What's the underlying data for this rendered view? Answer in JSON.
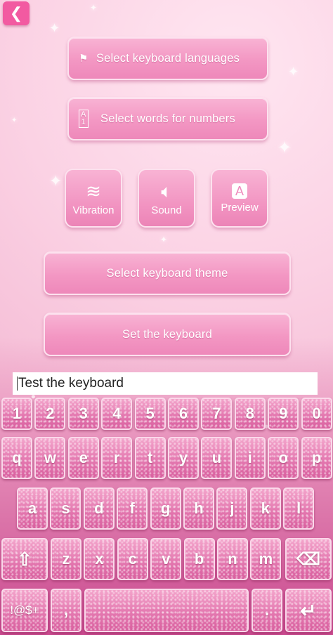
{
  "menu": {
    "languages_label": "Select keyboard languages",
    "numbers_label": "Select words for numbers",
    "vibration_label": "Vibration",
    "sound_label": "Sound",
    "preview_label": "Preview",
    "theme_label": "Select keyboard theme",
    "set_label": "Set the keyboard"
  },
  "icons": {
    "back": "chevron-left-icon",
    "languages": "flag-icon",
    "numbers": "a1-icon",
    "vibration": "vibration-icon",
    "sound": "speaker-icon",
    "preview": "preview-a-icon"
  },
  "test_field": {
    "value": "Test the keyboard"
  },
  "keyboard": {
    "row_numbers": [
      "1",
      "2",
      "3",
      "4",
      "5",
      "6",
      "7",
      "8",
      "9",
      "0"
    ],
    "row_top": [
      "q",
      "w",
      "e",
      "r",
      "t",
      "y",
      "u",
      "i",
      "o",
      "p"
    ],
    "row_middle": [
      "a",
      "s",
      "d",
      "f",
      "g",
      "h",
      "j",
      "k",
      "l"
    ],
    "row_bottom": [
      "z",
      "x",
      "c",
      "v",
      "b",
      "n",
      "m"
    ],
    "symbols_label": "!@$+",
    "comma": ",",
    "period": "."
  },
  "colors": {
    "accent": "#f25aa1",
    "button": "#f397c3",
    "key": "#e479b0"
  }
}
